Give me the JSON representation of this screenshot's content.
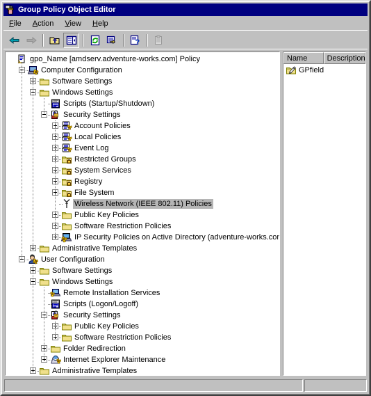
{
  "window": {
    "title": "Group Policy Object Editor",
    "title_icon": "gpo-console-icon"
  },
  "menubar": {
    "items": [
      {
        "label": "File",
        "accel": "F"
      },
      {
        "label": "Action",
        "accel": "A"
      },
      {
        "label": "View",
        "accel": "V"
      },
      {
        "label": "Help",
        "accel": "H"
      }
    ]
  },
  "toolbar": {
    "buttons": [
      {
        "name": "back-button",
        "icon": "left-arrow-icon",
        "enabled": true,
        "pressed": false
      },
      {
        "name": "forward-button",
        "icon": "right-arrow-icon",
        "enabled": false,
        "pressed": false
      },
      {
        "name": "up-one-level-button",
        "icon": "folder-up-icon",
        "enabled": true,
        "pressed": false
      },
      {
        "name": "show-hide-tree-button",
        "icon": "console-tree-icon",
        "enabled": true,
        "pressed": true
      },
      {
        "name": "refresh-button",
        "icon": "refresh-icon",
        "enabled": true,
        "pressed": false
      },
      {
        "name": "export-list-button",
        "icon": "export-list-icon",
        "enabled": true,
        "pressed": false
      },
      {
        "name": "help-button",
        "icon": "help-question-icon",
        "enabled": true,
        "pressed": false
      },
      {
        "name": "paste-button",
        "icon": "paste-icon",
        "enabled": false,
        "pressed": false
      }
    ]
  },
  "tree": {
    "nodes": [
      {
        "label": "gpo_Name [amdserv.adventure-works.com] Policy",
        "depth": 0,
        "icon": "gpo-root-icon",
        "expander": "none",
        "selected": false
      },
      {
        "label": "Computer Configuration",
        "depth": 1,
        "icon": "computer-config-icon",
        "expander": "minus",
        "selected": false
      },
      {
        "label": "Software Settings",
        "depth": 2,
        "icon": "folder-icon",
        "expander": "plus",
        "selected": false
      },
      {
        "label": "Windows Settings",
        "depth": 2,
        "icon": "folder-icon",
        "expander": "minus",
        "selected": false
      },
      {
        "label": "Scripts (Startup/Shutdown)",
        "depth": 3,
        "icon": "scripts-icon",
        "expander": "none",
        "selected": false
      },
      {
        "label": "Security Settings",
        "depth": 3,
        "icon": "security-settings-icon",
        "expander": "minus",
        "selected": false
      },
      {
        "label": "Account Policies",
        "depth": 4,
        "icon": "policy-node-icon",
        "expander": "plus",
        "selected": false
      },
      {
        "label": "Local Policies",
        "depth": 4,
        "icon": "policy-node-icon",
        "expander": "plus",
        "selected": false
      },
      {
        "label": "Event Log",
        "depth": 4,
        "icon": "policy-node-icon",
        "expander": "plus",
        "selected": false
      },
      {
        "label": "Restricted Groups",
        "depth": 4,
        "icon": "folder-lock-icon",
        "expander": "plus",
        "selected": false
      },
      {
        "label": "System Services",
        "depth": 4,
        "icon": "folder-lock-icon",
        "expander": "plus",
        "selected": false
      },
      {
        "label": "Registry",
        "depth": 4,
        "icon": "folder-lock-icon",
        "expander": "plus",
        "selected": false
      },
      {
        "label": "File System",
        "depth": 4,
        "icon": "folder-lock-icon",
        "expander": "plus",
        "selected": false
      },
      {
        "label": "Wireless Network (IEEE 802.11) Policies",
        "depth": 4,
        "icon": "wireless-antenna-icon",
        "expander": "none",
        "selected": true
      },
      {
        "label": "Public Key Policies",
        "depth": 4,
        "icon": "folder-icon",
        "expander": "plus",
        "selected": false
      },
      {
        "label": "Software Restriction Policies",
        "depth": 4,
        "icon": "folder-icon",
        "expander": "plus",
        "selected": false
      },
      {
        "label": "IP Security Policies on Active Directory (adventure-works.com)",
        "depth": 4,
        "icon": "ip-security-icon",
        "expander": "plus",
        "selected": false
      },
      {
        "label": "Administrative Templates",
        "depth": 2,
        "icon": "folder-icon",
        "expander": "plus",
        "selected": false
      },
      {
        "label": "User Configuration",
        "depth": 1,
        "icon": "user-config-icon",
        "expander": "minus",
        "selected": false
      },
      {
        "label": "Software Settings",
        "depth": 2,
        "icon": "folder-icon",
        "expander": "plus",
        "selected": false
      },
      {
        "label": "Windows Settings",
        "depth": 2,
        "icon": "folder-icon",
        "expander": "minus",
        "selected": false
      },
      {
        "label": "Remote Installation Services",
        "depth": 3,
        "icon": "remote-install-icon",
        "expander": "none",
        "selected": false
      },
      {
        "label": "Scripts (Logon/Logoff)",
        "depth": 3,
        "icon": "scripts-icon",
        "expander": "none",
        "selected": false
      },
      {
        "label": "Security Settings",
        "depth": 3,
        "icon": "security-settings-icon",
        "expander": "minus",
        "selected": false
      },
      {
        "label": "Public Key Policies",
        "depth": 4,
        "icon": "folder-icon",
        "expander": "plus",
        "selected": false
      },
      {
        "label": "Software Restriction Policies",
        "depth": 4,
        "icon": "folder-icon",
        "expander": "plus",
        "selected": false
      },
      {
        "label": "Folder Redirection",
        "depth": 3,
        "icon": "folder-icon",
        "expander": "plus",
        "selected": false
      },
      {
        "label": "Internet Explorer Maintenance",
        "depth": 3,
        "icon": "ie-maintenance-icon",
        "expander": "plus",
        "selected": false
      },
      {
        "label": "Administrative Templates",
        "depth": 2,
        "icon": "folder-icon",
        "expander": "plus",
        "selected": false
      }
    ]
  },
  "listview": {
    "columns": [
      "Name",
      "Description"
    ],
    "rows": [
      {
        "name": "GPfield",
        "description": "",
        "icon": "gp-field-folder-icon"
      }
    ]
  },
  "statusbar": {
    "main_text": "",
    "secondary_text": ""
  },
  "colors": {
    "titlebar": "#000080",
    "face": "#c0c0c0",
    "selection_inactive": "#b5b5b5",
    "folder_yellow": "#f0e08c",
    "folder_edge": "#808000"
  }
}
